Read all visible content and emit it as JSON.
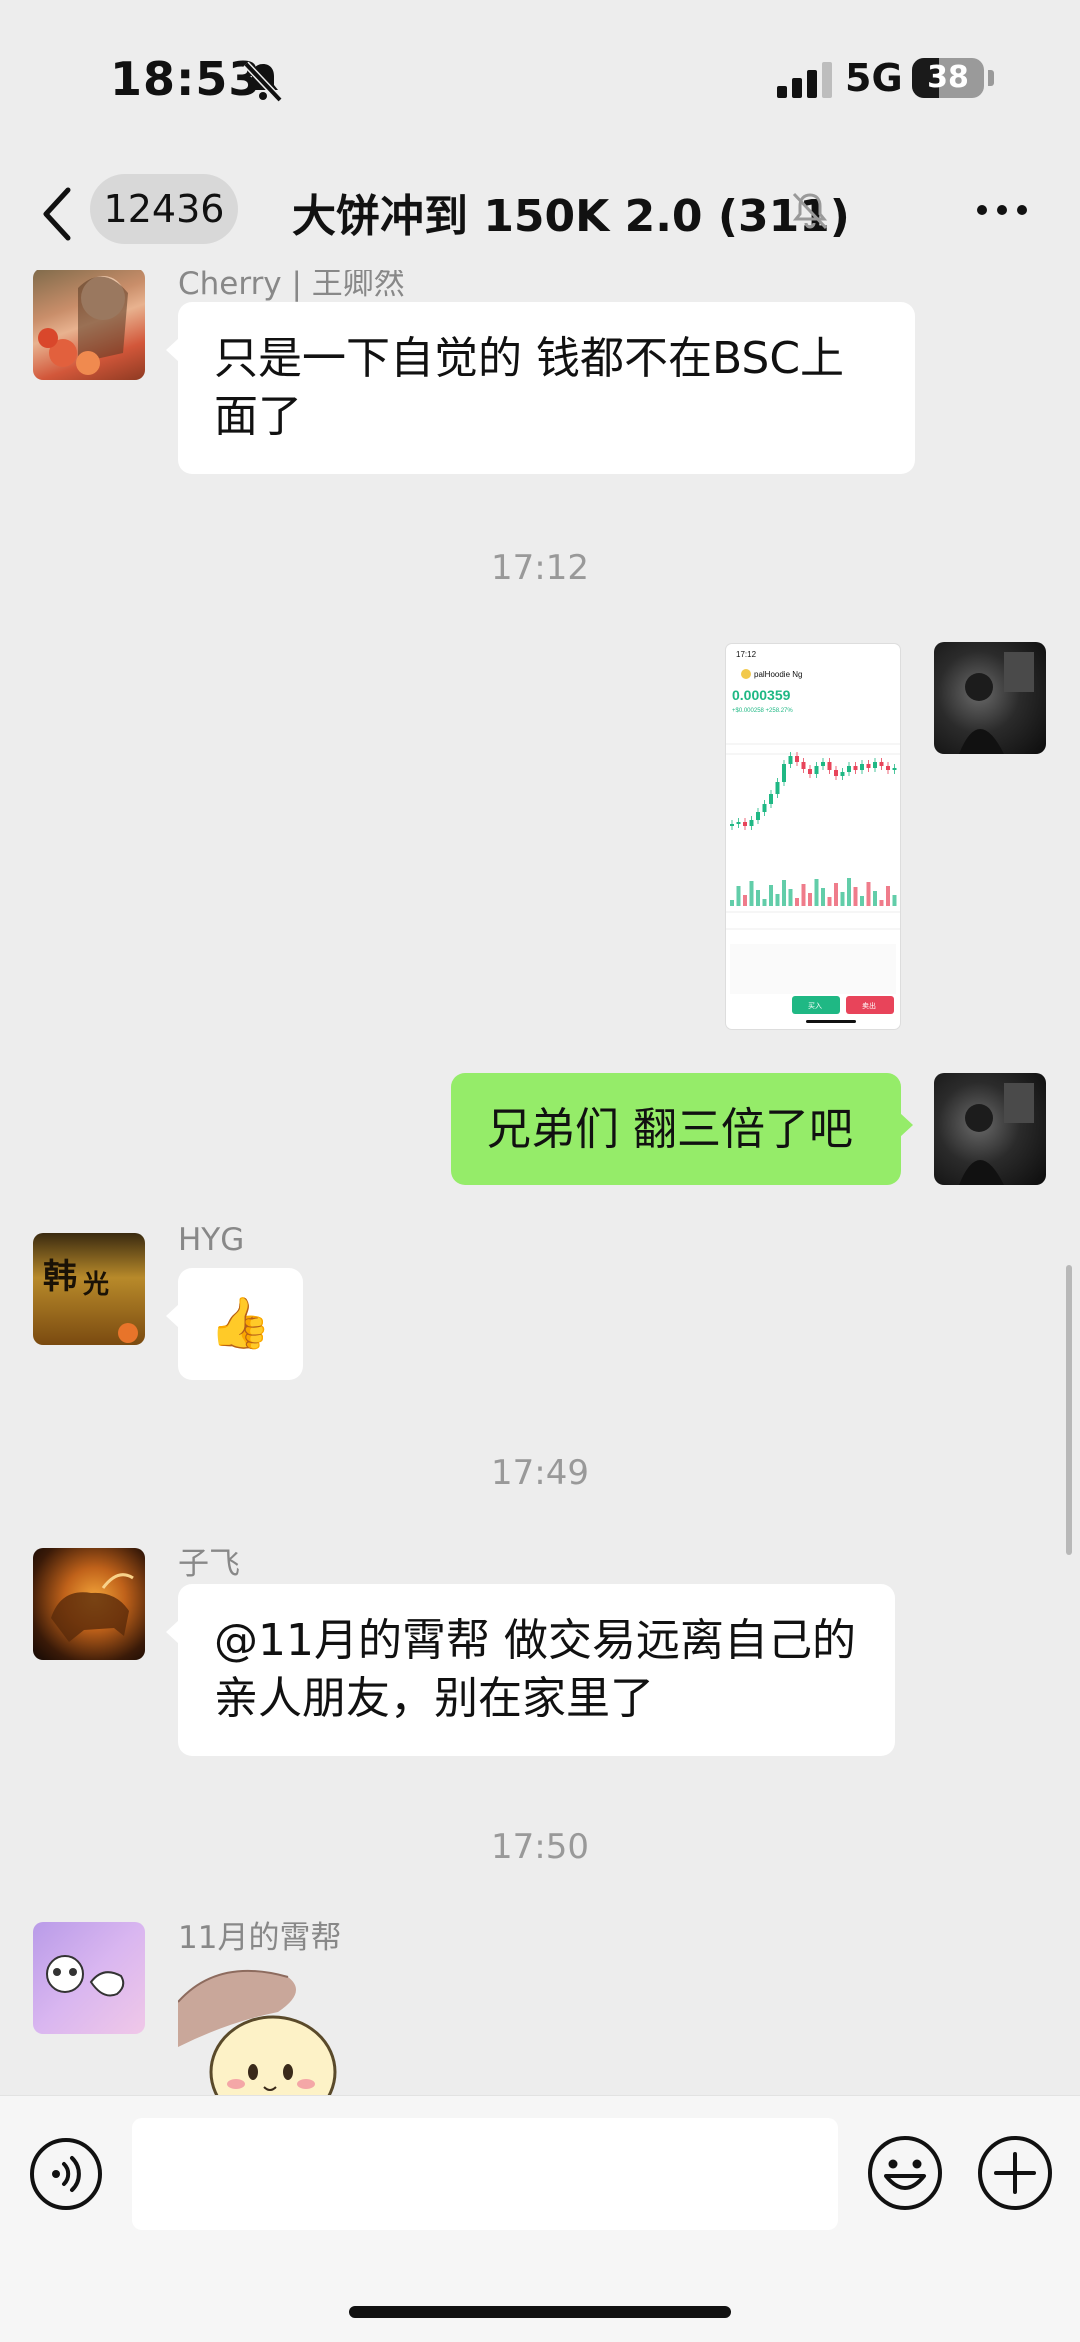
{
  "status_bar": {
    "time": "18:53",
    "network": "5G",
    "battery": "38",
    "battery_level": 0.38
  },
  "nav": {
    "unread_count": "12436",
    "title": "大饼冲到 150K 2.0 (311)",
    "muted_icon": "bell-slash-icon",
    "more_icon": "more-dots-icon",
    "back_icon": "chevron-left-icon"
  },
  "messages": {
    "m1": {
      "sender": "Cherry | 王卿然",
      "text": "只是一下自觉的 钱都不在BSC上面了"
    },
    "ts1": "17:12",
    "m2": {
      "type": "image",
      "self": true
    },
    "m3": {
      "text": "兄弟们 翻三倍了吧",
      "self": true
    },
    "m4": {
      "sender": "HYG",
      "emoji": "👍"
    },
    "ts2": "17:49",
    "m5": {
      "sender": "子飞",
      "text": "@11月的霄帮 做交易远离自己的亲人朋友，别在家里了"
    },
    "ts3": "17:50",
    "m6": {
      "sender": "11月的霄帮",
      "type": "sticker"
    }
  },
  "screenshot": {
    "time": "17:12",
    "pair": "palHoodie Ng",
    "price": "0.000359",
    "change": "+$0.000258 +258.27%",
    "buy_label": "买入",
    "sell_label": "卖出"
  },
  "input_bar": {
    "voice_icon": "voice-icon",
    "emoji_icon": "emoji-icon",
    "plus_icon": "plus-circle-icon"
  },
  "colors": {
    "background": "#ededed",
    "self_bubble": "#95ec69",
    "other_bubble": "#ffffff",
    "timestamp": "#999999",
    "chart_up": "#1fb884",
    "chart_down": "#e8445a"
  }
}
